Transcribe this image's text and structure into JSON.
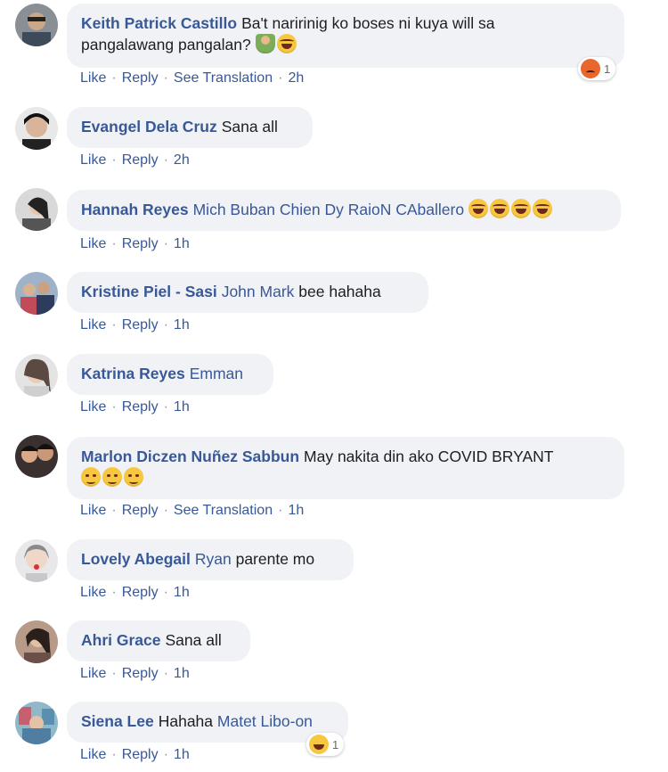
{
  "colors": {
    "author": "#385898",
    "bubble": "#f0f2f5",
    "text": "#1c1e21"
  },
  "actions": {
    "like": "Like",
    "reply": "Reply",
    "translate": "See Translation"
  },
  "comments": [
    {
      "author": "Keith Patrick Castillo",
      "text_line1": "Ba't naririnig ko boses ni kuya will sa",
      "text_line2": "pangalawang pangalan?",
      "emojis": [
        "person",
        "laugh"
      ],
      "time": "2h",
      "reaction": {
        "type": "angry",
        "count": "1"
      }
    },
    {
      "author": "Evangel Dela Cruz",
      "text": "Sana all",
      "time": "2h"
    },
    {
      "author": "Hannah Reyes",
      "mention": "Mich Buban Chien Dy RaioN CAballero",
      "emojis": [
        "laugh",
        "laugh",
        "laugh",
        "laugh"
      ],
      "time": "1h"
    },
    {
      "author": "Kristine Piel - Sasi",
      "mention": "John Mark",
      "text": "bee hahaha",
      "time": "1h"
    },
    {
      "author": "Katrina Reyes",
      "mention": "Emman",
      "time": "1h"
    },
    {
      "author": "Marlon Diczen Nuñez Sabbun",
      "text": "May nakita din ako COVID BRYANT",
      "emojis": [
        "smirk",
        "smirk",
        "smirk"
      ],
      "time": "1h"
    },
    {
      "author": "Lovely Abegail",
      "mention": "Ryan",
      "text": "parente mo",
      "time": "1h"
    },
    {
      "author": "Ahri Grace",
      "text": "Sana all",
      "time": "1h"
    },
    {
      "author": "Siena Lee",
      "text": "Hahaha",
      "mention": "Matet Libo-on",
      "time": "1h",
      "reaction": {
        "type": "haha",
        "count": "1"
      }
    }
  ]
}
